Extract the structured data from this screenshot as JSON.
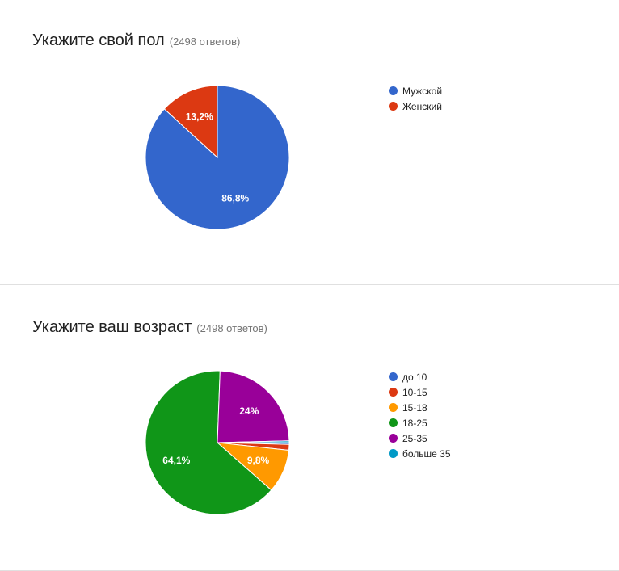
{
  "chart_data": [
    {
      "type": "pie",
      "title": "Укажите свой пол",
      "subtitle": "(2498 ответов)",
      "categories": [
        "Мужской",
        "Женский"
      ],
      "values": [
        86.8,
        13.2
      ],
      "data_labels": [
        "86,8%",
        "13,2%"
      ],
      "colors": [
        "#3366cc",
        "#dc3912"
      ],
      "legend_position": "right",
      "start_angle_deg": 90
    },
    {
      "type": "pie",
      "title": "Укажите ваш возраст",
      "subtitle": "(2498 ответов)",
      "categories": [
        "до 10",
        "10-15",
        "15-18",
        "18-25",
        "25-35",
        "больше 35"
      ],
      "values": [
        0.4,
        1.3,
        9.8,
        64.1,
        24.0,
        0.4
      ],
      "data_labels": [
        "",
        "",
        "9,8%",
        "64,1%",
        "24%",
        ""
      ],
      "colors": [
        "#3366cc",
        "#dc3912",
        "#ff9900",
        "#109618",
        "#990099",
        "#0099c6"
      ],
      "legend_position": "right",
      "start_angle_deg": 0
    }
  ]
}
